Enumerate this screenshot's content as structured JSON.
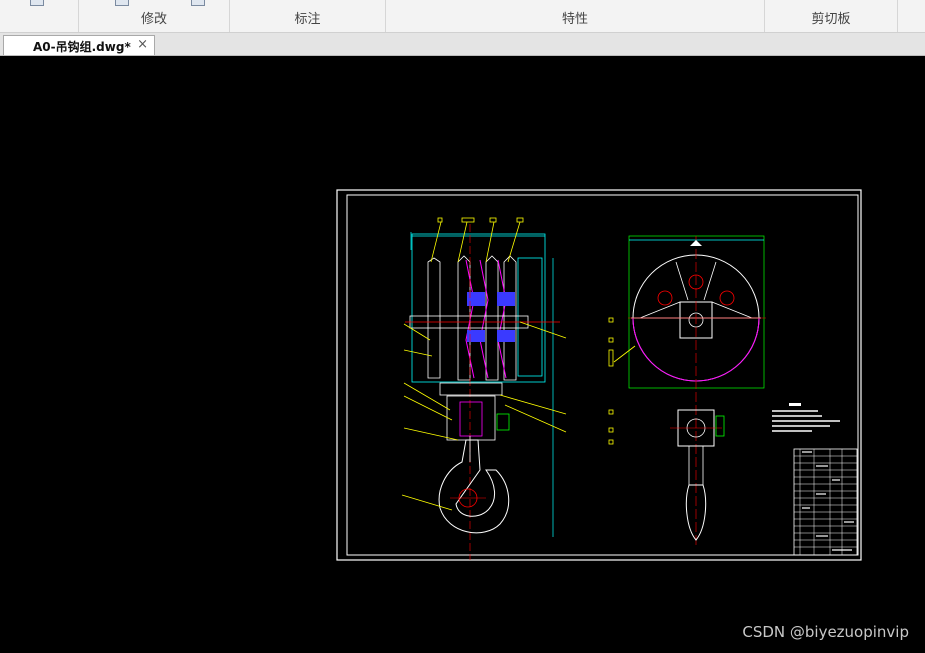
{
  "ribbon": {
    "groups": [
      {
        "label": "修改"
      },
      {
        "label": "标注"
      },
      {
        "label": "特性"
      },
      {
        "label": "剪切板"
      }
    ]
  },
  "tabs": {
    "active_document": "A0-吊钩组.dwg*",
    "close_symbol": "×"
  },
  "watermark": "CSDN @biyezuopinvip",
  "colors": {
    "canvas_background": "#000000",
    "drawing_frame": "#ffffff",
    "lines_yellow": "#ffff00",
    "lines_cyan": "#00ffff",
    "lines_red": "#ff0000",
    "lines_green": "#00ff00",
    "lines_blue": "#0000ff",
    "lines_magenta": "#ff00ff"
  }
}
